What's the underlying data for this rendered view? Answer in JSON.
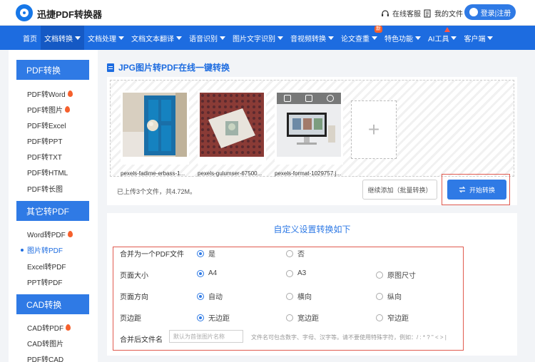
{
  "header": {
    "app_name": "迅捷PDF转换器",
    "service_link": "在线客服",
    "my_files_link": "我的文件",
    "login_label": "登录|注册"
  },
  "nav": {
    "items": [
      "首页",
      "文档转换",
      "文档处理",
      "文档文本翻译",
      "语音识别",
      "图片文字识别",
      "音视频转换",
      "论文查重",
      "特色功能",
      "AI工具",
      "客户端"
    ],
    "new_badge": "新"
  },
  "sidebar": {
    "sections": [
      {
        "title": "PDF转换",
        "items": [
          "PDF转Word",
          "PDF转图片",
          "PDF转Excel",
          "PDF转PPT",
          "PDF转TXT",
          "PDF转HTML",
          "PDF转长图"
        ]
      },
      {
        "title": "其它转PDF",
        "items": [
          "Word转PDF",
          "图片转PDF",
          "Excel转PDF",
          "PPT转PDF"
        ]
      },
      {
        "title": "CAD转换",
        "items": [
          "CAD转PDF",
          "CAD转图片",
          "PDF转CAD"
        ]
      }
    ]
  },
  "main": {
    "title": "JPG图片转PDF在线一键转换",
    "files": [
      {
        "name": "pexels-fadime-erbass-1..."
      },
      {
        "name": "pexels-gulumser-67500..."
      },
      {
        "name": "pexels-format-1029757.j..."
      }
    ],
    "add_symbol": "+",
    "upload_status": "已上传3个文件，共4.72M。",
    "continue_button": "继续添加（批量转换）",
    "start_button": "开始转换"
  },
  "settings": {
    "title": "自定义设置转换如下",
    "merge_label": "合并为一个PDF文件",
    "merge_options": [
      "是",
      "否"
    ],
    "size_label": "页面大小",
    "size_options": [
      "A4",
      "A3",
      "原图尺寸"
    ],
    "orientation_label": "页面方向",
    "orientation_options": [
      "自动",
      "横向",
      "纵向"
    ],
    "margin_label": "页边距",
    "margin_options": [
      "无边距",
      "宽边距",
      "窄边距"
    ],
    "filename_label": "合并后文件名",
    "filename_placeholder": "默认为首张图片名称",
    "filename_hint": "文件名可包含数字、字母、汉字等。请不要使用特殊字符，例如：/ : * ? \" < > |"
  },
  "colors": {
    "primary": "#2f7ae5",
    "nav_bg": "#1d6ce0",
    "highlight_box": "#e05a4f",
    "fire": "#f5602d"
  }
}
